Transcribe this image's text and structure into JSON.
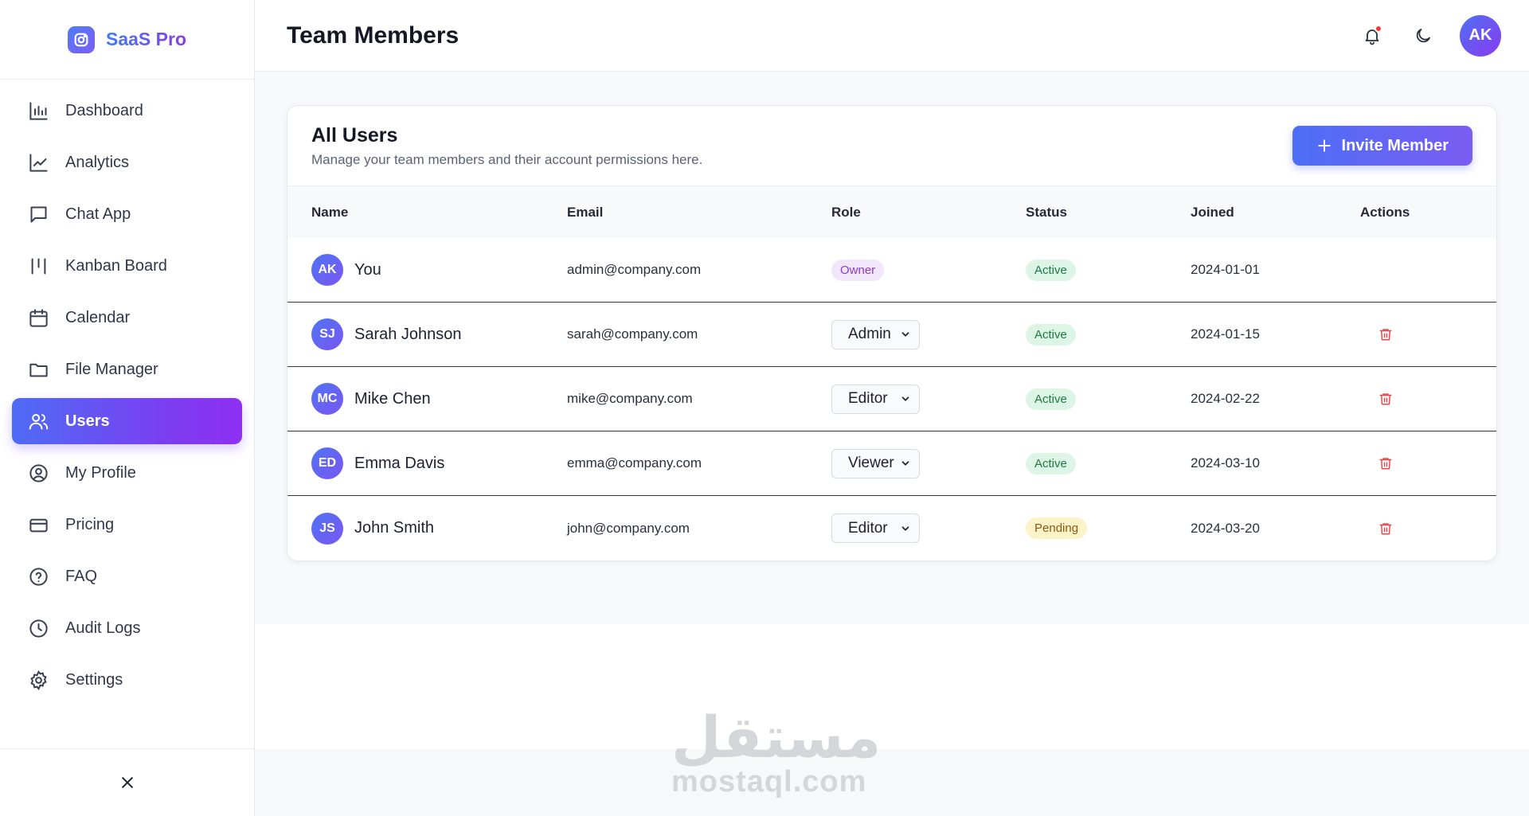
{
  "brand": {
    "name": "SaaS Pro"
  },
  "sidebar": {
    "items": [
      {
        "label": "Dashboard",
        "icon": "bar-chart-icon",
        "active": false
      },
      {
        "label": "Analytics",
        "icon": "line-chart-icon",
        "active": false
      },
      {
        "label": "Chat App",
        "icon": "chat-icon",
        "active": false
      },
      {
        "label": "Kanban Board",
        "icon": "kanban-icon",
        "active": false
      },
      {
        "label": "Calendar",
        "icon": "calendar-icon",
        "active": false
      },
      {
        "label": "File Manager",
        "icon": "folder-icon",
        "active": false
      },
      {
        "label": "Users",
        "icon": "users-icon",
        "active": true
      },
      {
        "label": "My Profile",
        "icon": "user-circle-icon",
        "active": false
      },
      {
        "label": "Pricing",
        "icon": "credit-card-icon",
        "active": false
      },
      {
        "label": "FAQ",
        "icon": "help-circle-icon",
        "active": false
      },
      {
        "label": "Audit Logs",
        "icon": "clock-icon",
        "active": false
      },
      {
        "label": "Settings",
        "icon": "gear-icon",
        "active": false
      }
    ],
    "footer_icon": "close-icon"
  },
  "header": {
    "title": "Team Members",
    "avatar_initials": "AK",
    "notification_dot_color": "#ef3b3b"
  },
  "card": {
    "title": "All Users",
    "subtitle": "Manage your team members and their account permissions here.",
    "invite_label": "Invite Member"
  },
  "table": {
    "headers": [
      "Name",
      "Email",
      "Role",
      "Status",
      "Joined",
      "Actions"
    ],
    "rows": [
      {
        "initials": "AK",
        "name": "You",
        "email": "admin@company.com",
        "role": "Owner",
        "status": "Active",
        "joined": "2024-01-01"
      },
      {
        "initials": "SJ",
        "name": "Sarah Johnson",
        "email": "sarah@company.com",
        "role": "Admin",
        "status": "Active",
        "joined": "2024-01-15"
      },
      {
        "initials": "MC",
        "name": "Mike Chen",
        "email": "mike@company.com",
        "role": "Editor",
        "status": "Active",
        "joined": "2024-02-22"
      },
      {
        "initials": "ED",
        "name": "Emma Davis",
        "email": "emma@company.com",
        "role": "Viewer",
        "status": "Active",
        "joined": "2024-03-10"
      },
      {
        "initials": "JS",
        "name": "John Smith",
        "email": "john@company.com",
        "role": "Editor",
        "status": "Pending",
        "joined": "2024-03-20"
      }
    ]
  },
  "watermark": {
    "arabic": "مستقل",
    "latin": "mostaql.com"
  },
  "colors": {
    "accent_start": "#4e6cf5",
    "accent_end": "#8e2ff2",
    "delete": "#e5484d",
    "active_badge": "#dcf5e6",
    "pending_badge": "#fcf3c8",
    "owner_badge": "#f2e6fb"
  }
}
